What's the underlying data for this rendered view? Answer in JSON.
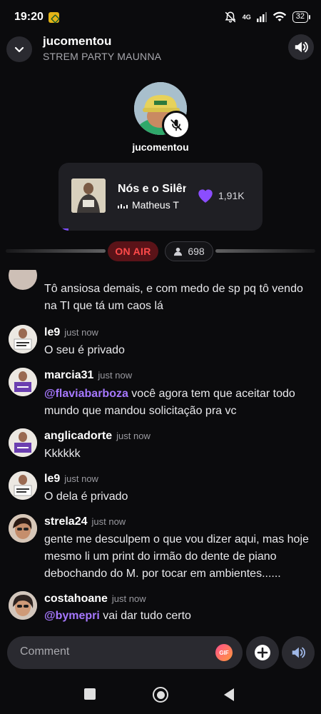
{
  "status_bar": {
    "time": "19:20",
    "network": "4G",
    "battery": "32"
  },
  "header": {
    "title": "jucomentou",
    "subtitle": "STREM PARTY MAUNNA"
  },
  "host": {
    "name": "jucomentou"
  },
  "music": {
    "song": "Nós e o Silêncio",
    "artist": "Matheus T",
    "likes": "1,91K",
    "progress": 0.05
  },
  "live": {
    "on_air_label": "ON AIR",
    "viewers": "698"
  },
  "chat": {
    "messages": [
      {
        "user": "",
        "time": "",
        "text": "Tô ansiosa demais, e com medo de sp pq tô vendo na TI que tá um caos lá"
      },
      {
        "user": "le9",
        "time": "just now",
        "text": "O seu é privado"
      },
      {
        "user": "marcia31",
        "time": "just now",
        "mention": "@flaviabarboza",
        "text": " você agora tem que aceitar todo mundo que mandou solicitação pra vc"
      },
      {
        "user": "anglicadorte",
        "time": "just now",
        "text": "Kkkkkk"
      },
      {
        "user": "le9",
        "time": "just now",
        "text": "O dela é privado"
      },
      {
        "user": "strela24",
        "time": "just now",
        "text": "gente me desculpem o que vou dizer aqui, mas hoje mesmo li um print do irmão do dente de piano debochando do M. por tocar em ambientes......"
      },
      {
        "user": "costahoane",
        "time": "just now",
        "mention": "@bymepri",
        "text": " vai dar tudo certo"
      }
    ]
  },
  "composer": {
    "placeholder": "Comment",
    "gif_label": "GIF"
  },
  "colors": {
    "accent": "#7c4dff",
    "on_air": "#ff4a4a",
    "mention": "#a678ff"
  }
}
